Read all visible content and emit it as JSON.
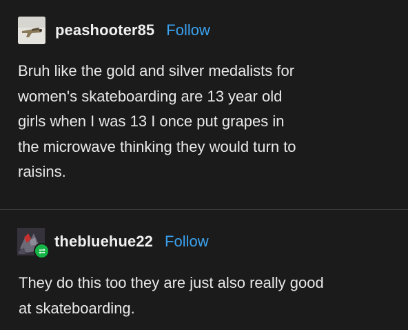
{
  "post1": {
    "username": "peashooter85",
    "follow_label": "Follow",
    "text": "Bruh like the gold and silver medalists for\nwomen's skateboarding are 13 year old\ngirls when I was 13 I once put grapes in\nthe microwave thinking they would turn to\nraisins."
  },
  "post2": {
    "username": "thebluehue22",
    "follow_label": "Follow",
    "text": "They do this too they are just also really good\nat skateboarding."
  },
  "colors": {
    "background": "#1b1b1b",
    "text": "#e9e9e9",
    "follow": "#3aa2ef",
    "reblog_badge": "#16b447"
  },
  "icons": {
    "post1_avatar": "avatar-image",
    "post2_avatar": "avatar-image",
    "reblog": "reblog-icon"
  }
}
